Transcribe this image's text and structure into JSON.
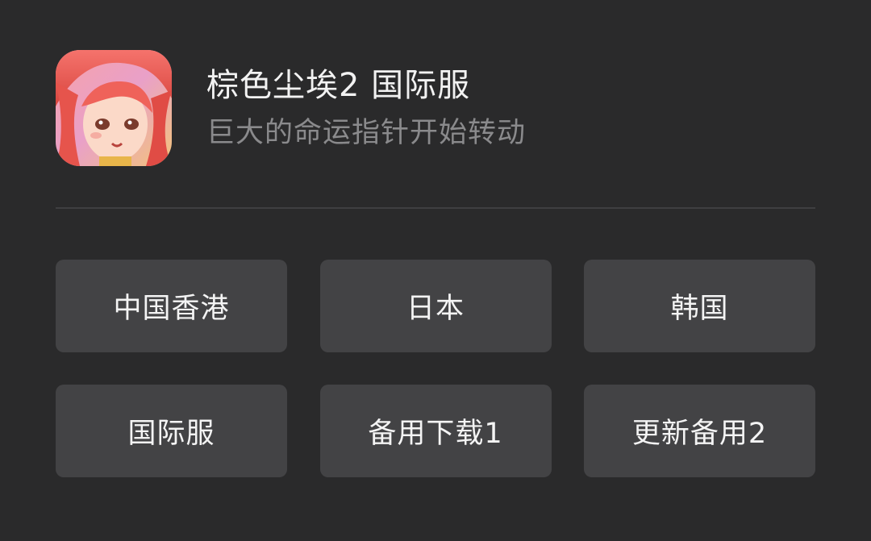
{
  "app": {
    "title": "棕色尘埃2 国际服",
    "subtitle": "巨大的命运指针开始转动",
    "icon": "anime-character-icon"
  },
  "regions": [
    {
      "label": "中国香港"
    },
    {
      "label": "日本"
    },
    {
      "label": "韩国"
    },
    {
      "label": "国际服"
    },
    {
      "label": "备用下载1"
    },
    {
      "label": "更新备用2"
    }
  ],
  "colors": {
    "background": "#2a2a2b",
    "button": "#434345",
    "title_text": "#f2f2f2",
    "subtitle_text": "#8a8a8c",
    "divider": "#3f3f41"
  }
}
